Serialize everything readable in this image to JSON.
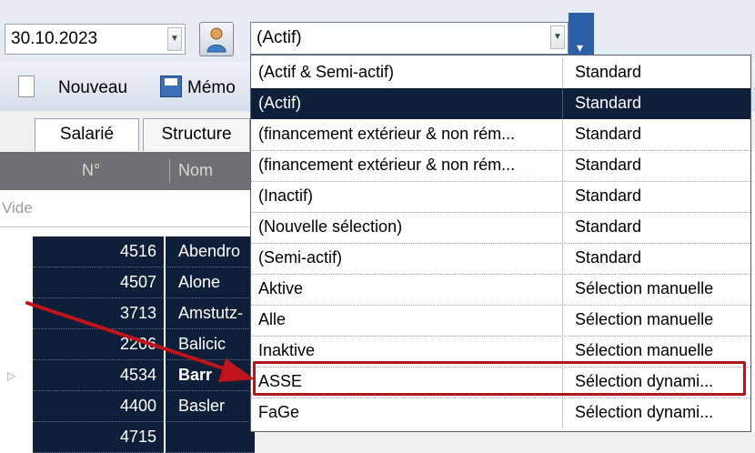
{
  "date_field": {
    "value": "30.10.2023"
  },
  "selection_field": {
    "value": "(Actif)"
  },
  "toolbar": {
    "new_label": "Nouveau",
    "save_label": "Mémo"
  },
  "tabs": [
    {
      "label": "Salarié"
    },
    {
      "label": "Structure"
    }
  ],
  "grid": {
    "headers": {
      "number": "N°",
      "name": "Nom"
    },
    "filter_text": "Vide",
    "rows": [
      {
        "number": "4516",
        "name": "Abendro"
      },
      {
        "number": "4507",
        "name": "Alone"
      },
      {
        "number": "3713",
        "name": "Amstutz-"
      },
      {
        "number": "2206",
        "name": "Balicic"
      },
      {
        "number": "4534",
        "name": "Barr"
      },
      {
        "number": "4400",
        "name": "Basler"
      },
      {
        "number": "4715",
        "name": ""
      }
    ]
  },
  "dropdown": {
    "options": [
      {
        "name": "(Actif & Semi-actif)",
        "type": "Standard"
      },
      {
        "name": "(Actif)",
        "type": "Standard",
        "selected": true
      },
      {
        "name": "(financement extérieur & non rém...",
        "type": "Standard"
      },
      {
        "name": "(financement extérieur & non rém...",
        "type": "Standard"
      },
      {
        "name": "(Inactif)",
        "type": "Standard"
      },
      {
        "name": "(Nouvelle sélection)",
        "type": "Standard"
      },
      {
        "name": "(Semi-actif)",
        "type": "Standard"
      },
      {
        "name": "Aktive",
        "type": "Sélection manuelle"
      },
      {
        "name": "Alle",
        "type": "Sélection manuelle"
      },
      {
        "name": "Inaktive",
        "type": "Sélection manuelle"
      },
      {
        "name": "ASSE",
        "type": "Sélection dynami..."
      },
      {
        "name": "FaGe",
        "type": "Sélection dynami..."
      }
    ]
  },
  "colors": {
    "selection": "#0f1f3a",
    "highlight_border": "#b0181c",
    "arrow": "#c0141a"
  }
}
